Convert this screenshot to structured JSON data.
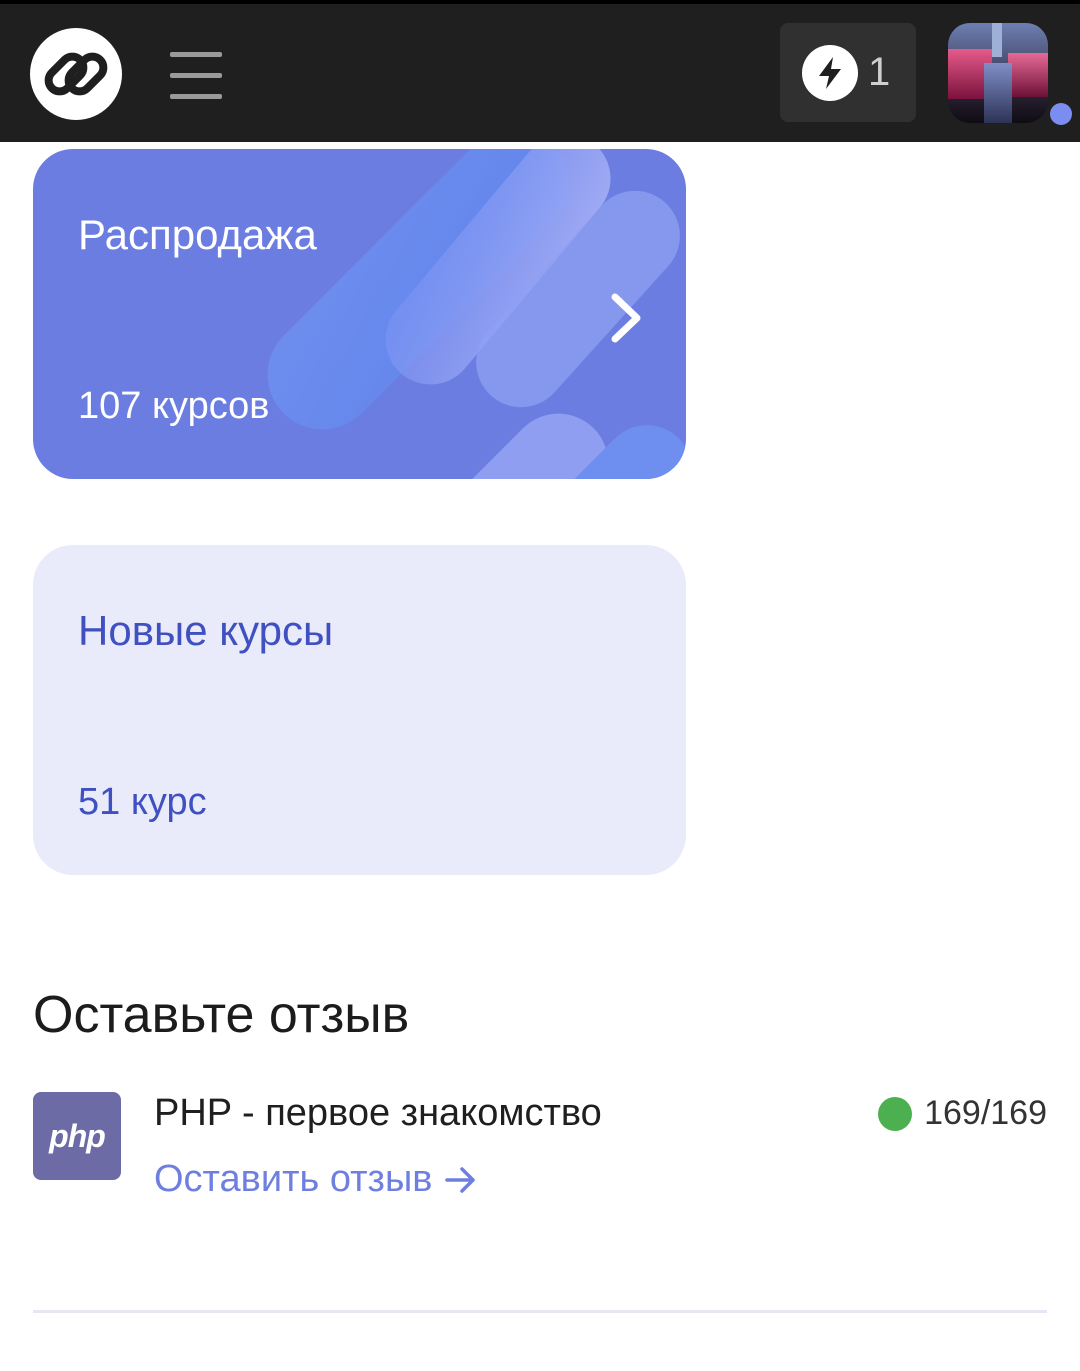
{
  "header": {
    "logo_icon": "link-logo-icon",
    "menu_icon": "hamburger-icon",
    "energy": {
      "icon": "lightning-icon",
      "count": "1"
    },
    "avatar_icon": "user-avatar",
    "online_color": "#7b8df0"
  },
  "cards": [
    {
      "title": "Распродажа",
      "count": "107 курсов",
      "chevron_icon": "chevron-right-icon",
      "bg": "#6b7de0"
    },
    {
      "title": "Новые курсы",
      "count": "51 курс",
      "bg": "#e9eafa"
    }
  ],
  "review": {
    "section_title": "Оставьте отзыв",
    "course": {
      "logo_text": "php",
      "name": "PHP - первое знакомство",
      "progress": "169/169",
      "progress_status_color": "#4caf50",
      "link_label": "Оставить отзыв",
      "link_icon": "arrow-right-icon"
    }
  },
  "colors": {
    "header": "#1f1f1f",
    "accent": "#6b7de0",
    "link": "#6f7fe0"
  }
}
